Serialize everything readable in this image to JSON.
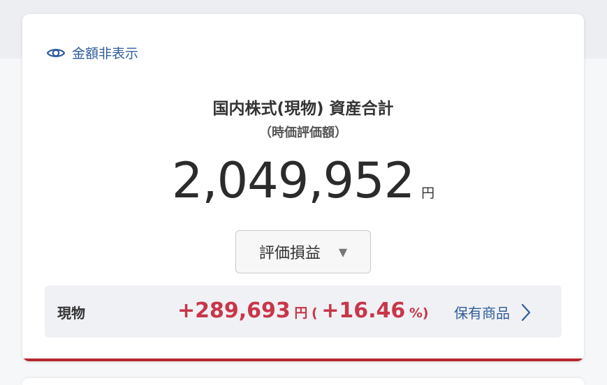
{
  "header": {
    "hide_amount_label": "金額非表示"
  },
  "summary": {
    "title": "国内株式(現物) 資産合計",
    "subtitle": "（時価評価額）",
    "total_value": "2,049,952",
    "total_unit": "円"
  },
  "selector": {
    "label": "評価損益",
    "caret": "▼"
  },
  "holding_row": {
    "label": "現物",
    "gain_value": "+289,693",
    "gain_unit": "円",
    "paren_open": "(",
    "percent_value": "+16.46",
    "percent_unit": "%)",
    "link_label": "保有商品"
  },
  "colors": {
    "accent_link": "#2f5c9c",
    "gain_red": "#c8364a",
    "card_bottom_line": "#b8272e"
  }
}
